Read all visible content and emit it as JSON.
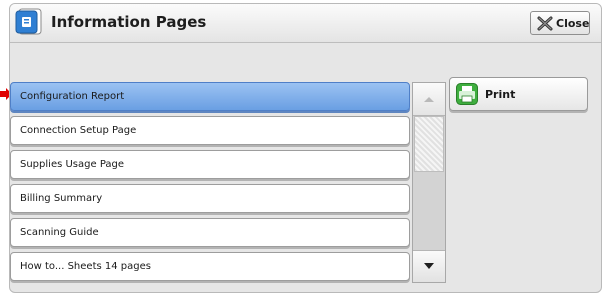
{
  "header": {
    "title": "Information Pages",
    "close_label": "Close",
    "app_icon": "information-pages-icon"
  },
  "list": {
    "items": [
      {
        "label": "Configuration Report",
        "selected": true
      },
      {
        "label": "Connection Setup Page",
        "selected": false
      },
      {
        "label": "Supplies Usage Page",
        "selected": false
      },
      {
        "label": "Billing Summary",
        "selected": false
      },
      {
        "label": "Scanning Guide",
        "selected": false
      },
      {
        "label": "How to... Sheets 14 pages",
        "selected": false
      }
    ]
  },
  "scrollbar": {
    "position": 0,
    "up_enabled": false,
    "down_enabled": true
  },
  "actions": {
    "print_label": "Print",
    "print_icon": "printer-icon"
  },
  "colors": {
    "selection": "#7aa9e8",
    "pointer_arrow": "#e00000",
    "print_icon": "#3fae3f",
    "app_icon": "#2f7fd3"
  }
}
